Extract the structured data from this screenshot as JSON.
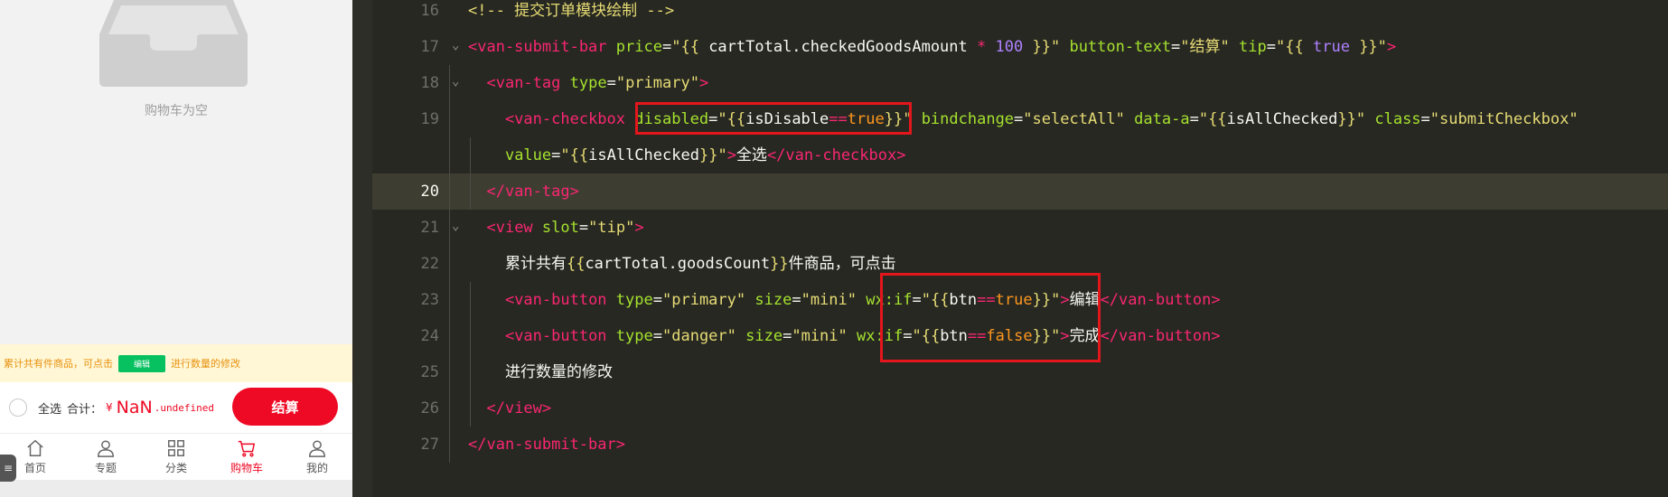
{
  "simulator": {
    "empty_text": "购物车为空",
    "tip_bar": {
      "text_before": "累计共有件商品，可点击",
      "edit_button": "编辑",
      "text_after": "进行数量的修改"
    },
    "submit_bar": {
      "select_all": "全选",
      "total_label": "合计：",
      "currency": "¥",
      "price_int": "NaN",
      "price_dec": ".undefined",
      "button": "结算"
    },
    "tabs": [
      {
        "label": "首页",
        "icon": "home-icon",
        "active": false
      },
      {
        "label": "专题",
        "icon": "user-icon",
        "active": false
      },
      {
        "label": "分类",
        "icon": "grid-icon",
        "active": false
      },
      {
        "label": "购物车",
        "icon": "cart-icon",
        "active": true
      },
      {
        "label": "我的",
        "icon": "user-icon",
        "active": false
      }
    ],
    "menu_glyph": "≡",
    "colors": {
      "primary_red": "#ee0a24",
      "tip_bg": "#fff7d6",
      "tip_text": "#e8910f",
      "edit_green": "#07c160"
    }
  },
  "editor": {
    "current_line": "20",
    "lines": [
      {
        "n": "16",
        "fold": "",
        "tokens": [
          {
            "c": "t-cmt",
            "t": "<!-- 提交订单模块绘制 -->"
          }
        ]
      },
      {
        "n": "17",
        "fold": "v",
        "tokens": [
          {
            "c": "t-tag",
            "t": "<van-submit-bar"
          },
          {
            "c": "t-pun",
            "t": " "
          },
          {
            "c": "t-attr",
            "t": "price"
          },
          {
            "c": "t-pun",
            "t": "="
          },
          {
            "c": "t-str",
            "t": "\""
          },
          {
            "c": "t-brace",
            "t": "{{"
          },
          {
            "c": "t-pun",
            "t": " cartTotal.checkedGoodsAmount "
          },
          {
            "c": "t-op",
            "t": "*"
          },
          {
            "c": "t-pun",
            "t": " "
          },
          {
            "c": "t-kw",
            "t": "100"
          },
          {
            "c": "t-pun",
            "t": " "
          },
          {
            "c": "t-brace",
            "t": "}}"
          },
          {
            "c": "t-str",
            "t": "\""
          },
          {
            "c": "t-pun",
            "t": " "
          },
          {
            "c": "t-attr",
            "t": "button-text"
          },
          {
            "c": "t-pun",
            "t": "="
          },
          {
            "c": "t-str",
            "t": "\"结算\""
          },
          {
            "c": "t-pun",
            "t": " "
          },
          {
            "c": "t-attr",
            "t": "tip"
          },
          {
            "c": "t-pun",
            "t": "="
          },
          {
            "c": "t-str",
            "t": "\""
          },
          {
            "c": "t-brace",
            "t": "{{"
          },
          {
            "c": "t-pun",
            "t": " "
          },
          {
            "c": "t-kw",
            "t": "true"
          },
          {
            "c": "t-pun",
            "t": " "
          },
          {
            "c": "t-brace",
            "t": "}}"
          },
          {
            "c": "t-str",
            "t": "\""
          },
          {
            "c": "t-tag",
            "t": ">"
          }
        ]
      },
      {
        "n": "18",
        "fold": "v",
        "tokens": [
          {
            "c": "t-pun",
            "t": "  "
          },
          {
            "c": "t-tag",
            "t": "<van-tag"
          },
          {
            "c": "t-pun",
            "t": " "
          },
          {
            "c": "t-attr",
            "t": "type"
          },
          {
            "c": "t-pun",
            "t": "="
          },
          {
            "c": "t-str",
            "t": "\"primary\""
          },
          {
            "c": "t-tag",
            "t": ">"
          }
        ]
      },
      {
        "n": "19",
        "fold": "",
        "tokens": [
          {
            "c": "t-pun",
            "t": "    "
          },
          {
            "c": "t-tag",
            "t": "<van-checkbox"
          },
          {
            "c": "t-pun",
            "t": " "
          },
          {
            "c": "t-attr",
            "t": "disabled"
          },
          {
            "c": "t-pun",
            "t": "="
          },
          {
            "c": "t-str",
            "t": "\""
          },
          {
            "c": "t-brace",
            "t": "{{"
          },
          {
            "c": "t-pun",
            "t": "isDisable"
          },
          {
            "c": "t-op",
            "t": "=="
          },
          {
            "c": "t-var",
            "t": "true"
          },
          {
            "c": "t-brace",
            "t": "}}"
          },
          {
            "c": "t-str",
            "t": "\""
          },
          {
            "c": "t-pun",
            "t": " "
          },
          {
            "c": "t-attr",
            "t": "bindchange"
          },
          {
            "c": "t-pun",
            "t": "="
          },
          {
            "c": "t-str",
            "t": "\"selectAll\""
          },
          {
            "c": "t-pun",
            "t": " "
          },
          {
            "c": "t-attr",
            "t": "data-a"
          },
          {
            "c": "t-pun",
            "t": "="
          },
          {
            "c": "t-str",
            "t": "\""
          },
          {
            "c": "t-brace",
            "t": "{{"
          },
          {
            "c": "t-pun",
            "t": "isAllChecked"
          },
          {
            "c": "t-brace",
            "t": "}}"
          },
          {
            "c": "t-str",
            "t": "\""
          },
          {
            "c": "t-pun",
            "t": " "
          },
          {
            "c": "t-attr",
            "t": "class"
          },
          {
            "c": "t-pun",
            "t": "="
          },
          {
            "c": "t-str",
            "t": "\"submitCheckbox\""
          }
        ]
      },
      {
        "n": "",
        "fold": "",
        "tokens": [
          {
            "c": "t-pun",
            "t": "    "
          },
          {
            "c": "t-attr",
            "t": "value"
          },
          {
            "c": "t-pun",
            "t": "="
          },
          {
            "c": "t-str",
            "t": "\""
          },
          {
            "c": "t-brace",
            "t": "{{"
          },
          {
            "c": "t-pun",
            "t": "isAllChecked"
          },
          {
            "c": "t-brace",
            "t": "}}"
          },
          {
            "c": "t-str",
            "t": "\""
          },
          {
            "c": "t-tag",
            "t": ">"
          },
          {
            "c": "t-pun",
            "t": "全选"
          },
          {
            "c": "t-tag",
            "t": "</van-checkbox>"
          }
        ]
      },
      {
        "n": "20",
        "fold": "",
        "tokens": [
          {
            "c": "t-pun",
            "t": "  "
          },
          {
            "c": "t-tag",
            "t": "</van-tag>"
          }
        ]
      },
      {
        "n": "21",
        "fold": "v",
        "tokens": [
          {
            "c": "t-pun",
            "t": "  "
          },
          {
            "c": "t-tag",
            "t": "<view"
          },
          {
            "c": "t-pun",
            "t": " "
          },
          {
            "c": "t-attr",
            "t": "slot"
          },
          {
            "c": "t-pun",
            "t": "="
          },
          {
            "c": "t-str",
            "t": "\"tip\""
          },
          {
            "c": "t-tag",
            "t": ">"
          }
        ]
      },
      {
        "n": "22",
        "fold": "",
        "tokens": [
          {
            "c": "t-pun",
            "t": "    累计共有"
          },
          {
            "c": "t-brace",
            "t": "{{"
          },
          {
            "c": "t-pun",
            "t": "cartTotal.goodsCount"
          },
          {
            "c": "t-brace",
            "t": "}}"
          },
          {
            "c": "t-pun",
            "t": "件商品，可点击"
          }
        ]
      },
      {
        "n": "23",
        "fold": "",
        "tokens": [
          {
            "c": "t-pun",
            "t": "    "
          },
          {
            "c": "t-tag",
            "t": "<van-button"
          },
          {
            "c": "t-pun",
            "t": " "
          },
          {
            "c": "t-attr",
            "t": "type"
          },
          {
            "c": "t-pun",
            "t": "="
          },
          {
            "c": "t-str",
            "t": "\"primary\""
          },
          {
            "c": "t-pun",
            "t": " "
          },
          {
            "c": "t-attr",
            "t": "size"
          },
          {
            "c": "t-pun",
            "t": "="
          },
          {
            "c": "t-str",
            "t": "\"mini\""
          },
          {
            "c": "t-pun",
            "t": " "
          },
          {
            "c": "t-attr",
            "t": "wx:if"
          },
          {
            "c": "t-pun",
            "t": "="
          },
          {
            "c": "t-str",
            "t": "\""
          },
          {
            "c": "t-brace",
            "t": "{{"
          },
          {
            "c": "t-pun",
            "t": "btn"
          },
          {
            "c": "t-op",
            "t": "=="
          },
          {
            "c": "t-var",
            "t": "true"
          },
          {
            "c": "t-brace",
            "t": "}}"
          },
          {
            "c": "t-str",
            "t": "\""
          },
          {
            "c": "t-tag",
            "t": ">"
          },
          {
            "c": "t-pun",
            "t": "编辑"
          },
          {
            "c": "t-tag",
            "t": "</van-button>"
          }
        ]
      },
      {
        "n": "24",
        "fold": "",
        "tokens": [
          {
            "c": "t-pun",
            "t": "    "
          },
          {
            "c": "t-tag",
            "t": "<van-button"
          },
          {
            "c": "t-pun",
            "t": " "
          },
          {
            "c": "t-attr",
            "t": "type"
          },
          {
            "c": "t-pun",
            "t": "="
          },
          {
            "c": "t-str",
            "t": "\"danger\""
          },
          {
            "c": "t-pun",
            "t": " "
          },
          {
            "c": "t-attr",
            "t": "size"
          },
          {
            "c": "t-pun",
            "t": "="
          },
          {
            "c": "t-str",
            "t": "\"mini\""
          },
          {
            "c": "t-pun",
            "t": " "
          },
          {
            "c": "t-attr",
            "t": "wx:if"
          },
          {
            "c": "t-pun",
            "t": "="
          },
          {
            "c": "t-str",
            "t": "\""
          },
          {
            "c": "t-brace",
            "t": "{{"
          },
          {
            "c": "t-pun",
            "t": "btn"
          },
          {
            "c": "t-op",
            "t": "=="
          },
          {
            "c": "t-var",
            "t": "false"
          },
          {
            "c": "t-brace",
            "t": "}}"
          },
          {
            "c": "t-str",
            "t": "\""
          },
          {
            "c": "t-tag",
            "t": ">"
          },
          {
            "c": "t-pun",
            "t": "完成"
          },
          {
            "c": "t-tag",
            "t": "</van-button>"
          }
        ]
      },
      {
        "n": "25",
        "fold": "",
        "tokens": [
          {
            "c": "t-pun",
            "t": "    进行数量的修改"
          }
        ]
      },
      {
        "n": "26",
        "fold": "",
        "tokens": [
          {
            "c": "t-pun",
            "t": "  "
          },
          {
            "c": "t-tag",
            "t": "</view>"
          }
        ]
      },
      {
        "n": "27",
        "fold": "",
        "tokens": [
          {
            "c": "t-tag",
            "t": "</van-submit-bar>"
          }
        ]
      }
    ],
    "highlight_color": "#e3161c"
  }
}
